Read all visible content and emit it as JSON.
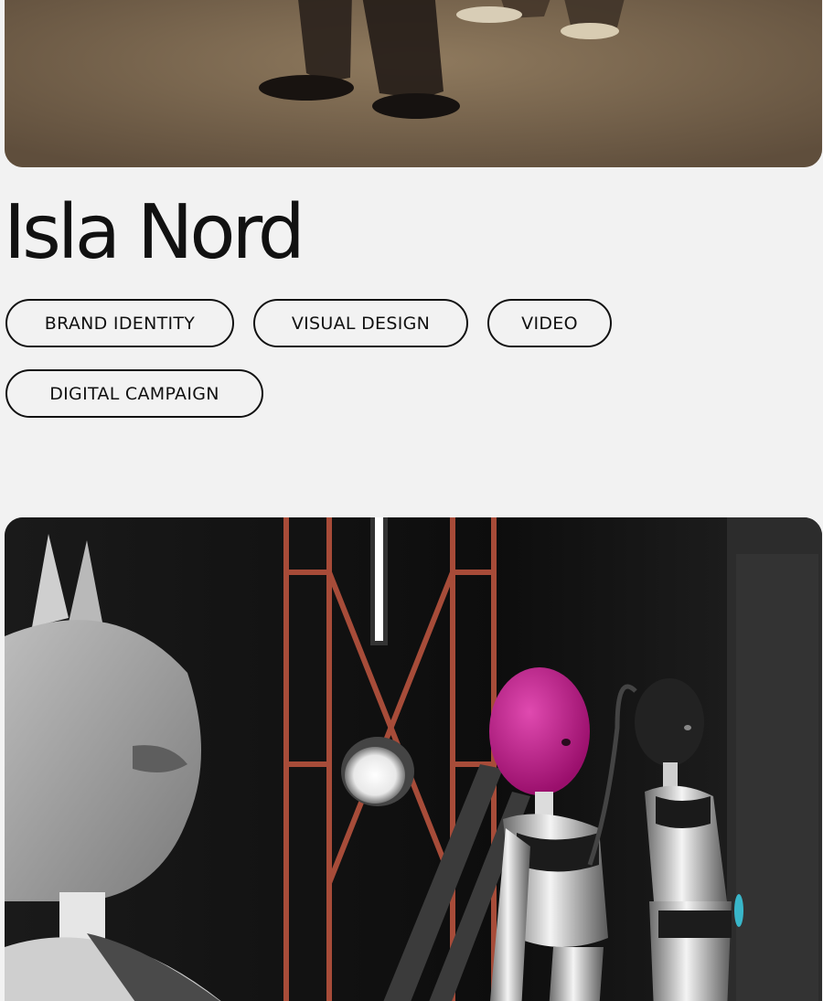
{
  "project": {
    "title": "Isla Nord",
    "tags": [
      {
        "label": "BRAND IDENTITY"
      },
      {
        "label": "VISUAL DESIGN"
      },
      {
        "label": "VIDEO"
      },
      {
        "label": "DIGITAL CAMPAIGN"
      }
    ]
  },
  "media": {
    "top_image": "dancers-on-floor-photo",
    "bottom_image": "3d-mannequins-scene"
  },
  "colors": {
    "background": "#f2f2f2",
    "text": "#111111",
    "tag_border": "#111111",
    "accent_magenta": "#c21a8e"
  }
}
